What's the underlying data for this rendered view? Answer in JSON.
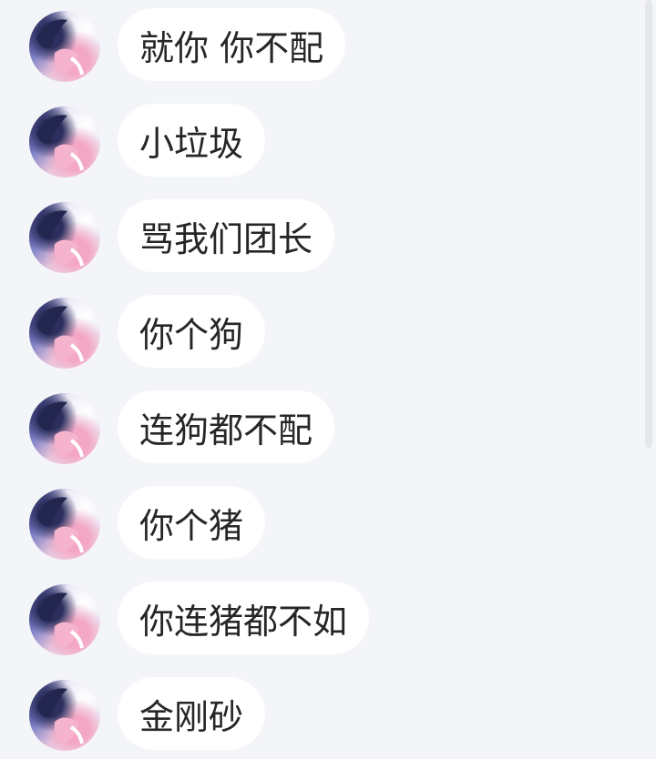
{
  "messages": [
    {
      "text": "就你 你不配"
    },
    {
      "text": "小垃圾"
    },
    {
      "text": "骂我们团长"
    },
    {
      "text": "你个狗"
    },
    {
      "text": "连狗都不配"
    },
    {
      "text": "你个猪"
    },
    {
      "text": "你连猪都不如"
    },
    {
      "text": "金刚砂"
    }
  ],
  "colors": {
    "background": "#f4f5f8",
    "bubble": "#ffffff",
    "text": "#262626"
  }
}
